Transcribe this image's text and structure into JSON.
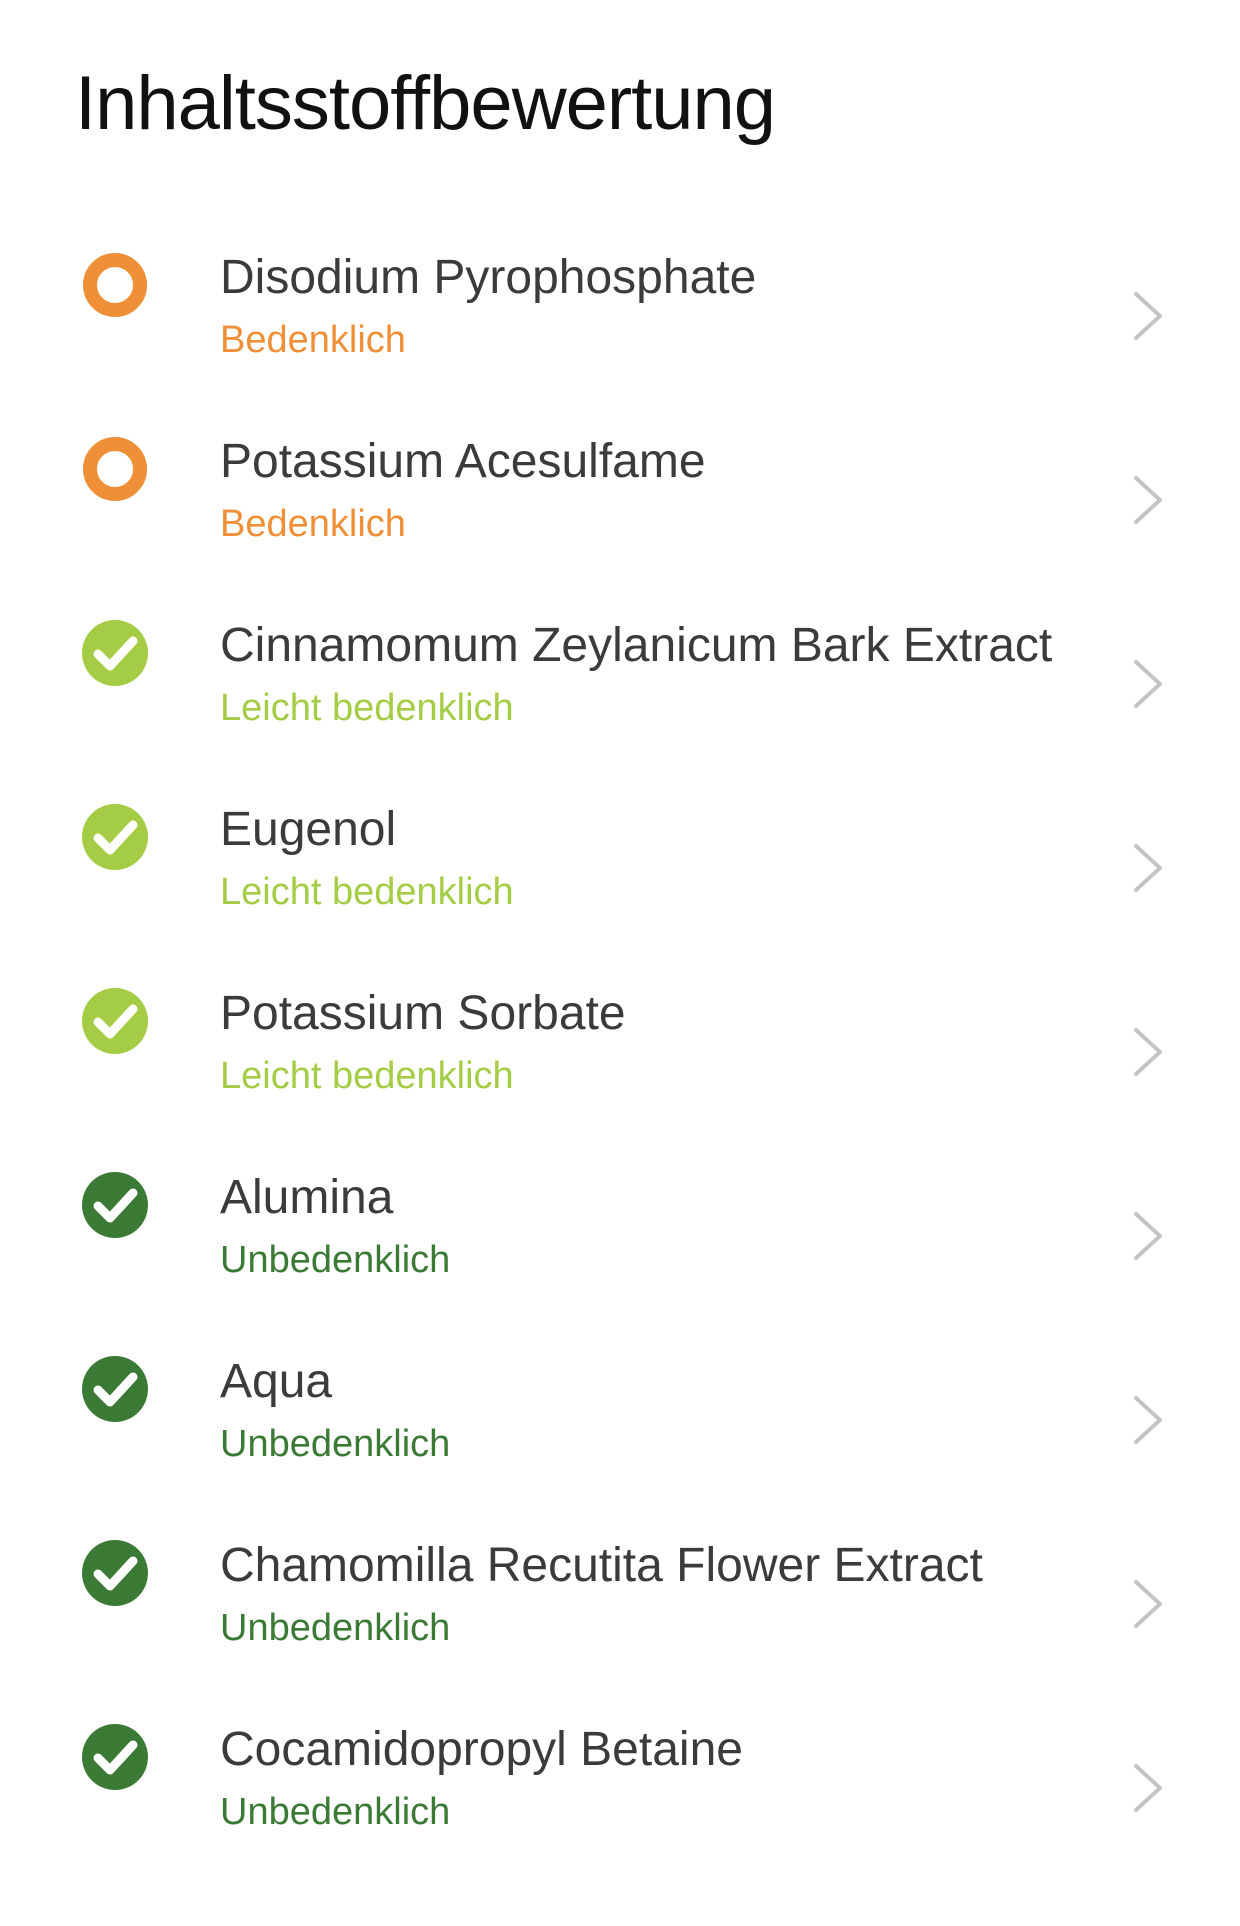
{
  "header": {
    "title": "Inhaltsstoffbewertung"
  },
  "colors": {
    "bedenklich": "#ef9038",
    "leicht_bedenklich": "#a5cc45",
    "unbedenklich": "#3a7a34",
    "chevron": "#c4c4c4",
    "name_text": "#3b3b3b"
  },
  "ingredients": [
    {
      "name": "Disodium Pyrophosphate",
      "rating": "Bedenklich",
      "level": "bedenklich",
      "icon": "orange-ring-icon"
    },
    {
      "name": "Potassium Acesulfame",
      "rating": "Bedenklich",
      "level": "bedenklich",
      "icon": "orange-ring-icon"
    },
    {
      "name": "Cinnamomum Zeylanicum Bark Extract",
      "rating": "Leicht bedenklich",
      "level": "leicht_bedenklich",
      "icon": "light-green-check-icon"
    },
    {
      "name": "Eugenol",
      "rating": "Leicht bedenklich",
      "level": "leicht_bedenklich",
      "icon": "light-green-check-icon"
    },
    {
      "name": "Potassium Sorbate",
      "rating": "Leicht bedenklich",
      "level": "leicht_bedenklich",
      "icon": "light-green-check-icon"
    },
    {
      "name": "Alumina",
      "rating": "Unbedenklich",
      "level": "unbedenklich",
      "icon": "dark-green-check-icon"
    },
    {
      "name": "Aqua",
      "rating": "Unbedenklich",
      "level": "unbedenklich",
      "icon": "dark-green-check-icon"
    },
    {
      "name": "Chamomilla Recutita Flower Extract",
      "rating": "Unbedenklich",
      "level": "unbedenklich",
      "icon": "dark-green-check-icon"
    },
    {
      "name": "Cocamidopropyl Betaine",
      "rating": "Unbedenklich",
      "level": "unbedenklich",
      "icon": "dark-green-check-icon"
    }
  ]
}
